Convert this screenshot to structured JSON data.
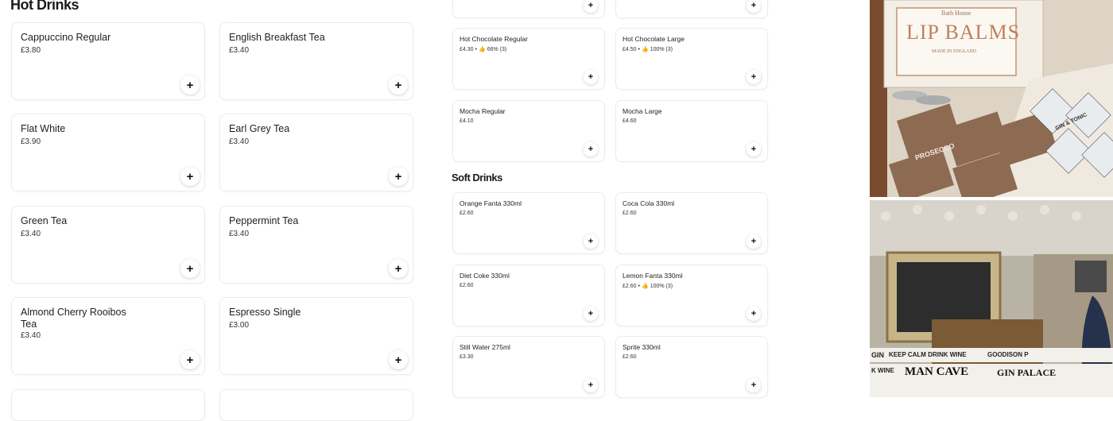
{
  "hot_drinks": {
    "title": "Hot Drinks",
    "left_items": [
      {
        "name": "Cappuccino Regular",
        "price": "£3.80"
      },
      {
        "name": "Flat White",
        "price": "£3.90"
      },
      {
        "name": "Green Tea",
        "price": "£3.40"
      },
      {
        "name": "Almond Cherry Rooibos Tea",
        "price": "£3.40"
      }
    ],
    "right_items": [
      {
        "name": "English Breakfast Tea",
        "price": "£3.40"
      },
      {
        "name": "Earl Grey Tea",
        "price": "£3.40"
      },
      {
        "name": "Peppermint Tea",
        "price": "£3.40"
      },
      {
        "name": "Espresso Single",
        "price": "£3.00"
      }
    ]
  },
  "hot_drinks_continued": [
    {
      "name": "Hot Chocolate Regular",
      "price": "£4.30",
      "rating": "66% (3)"
    },
    {
      "name": "Hot Chocolate Large",
      "price": "£4.50",
      "rating": "100% (3)"
    },
    {
      "name": "Mocha Regular",
      "price": "£4.10",
      "rating": ""
    },
    {
      "name": "Mocha Large",
      "price": "£4.60",
      "rating": ""
    }
  ],
  "soft_drinks": {
    "title": "Soft Drinks",
    "items": [
      {
        "name": "Orange Fanta 330ml",
        "price": "£2.60",
        "rating": ""
      },
      {
        "name": "Coca Cola 330ml",
        "price": "£2.60",
        "rating": ""
      },
      {
        "name": "Diet Coke 330ml",
        "price": "£2.60",
        "rating": ""
      },
      {
        "name": "Lemon Fanta 330ml",
        "price": "£2.60",
        "rating": "100% (3)"
      },
      {
        "name": "Still Water 275ml",
        "price": "£3.30",
        "rating": ""
      },
      {
        "name": "Sprite 330ml",
        "price": "£2.60",
        "rating": ""
      }
    ]
  },
  "photos": {
    "top_brand": "Bath House",
    "top_product": "LIP BALMS",
    "top_made_in": "MADE IN ENGLAND",
    "top_tin_a": "PROSECCO",
    "top_tin_b": "GIN & TONIC",
    "bottom_signs": [
      "KEEP CALM DRINK WINE",
      "GOODISON P",
      "MAN CAVE",
      "GIN PALACE",
      "GIN",
      "K WINE"
    ]
  },
  "icons": {
    "add": "plus-icon",
    "rating": "thumbs-up-icon"
  },
  "colors": {
    "border": "#ececec",
    "text": "#1f1f1f",
    "photo_bg_top": "#e9e2d8",
    "photo_bg_bottom": "#6b5a45"
  }
}
